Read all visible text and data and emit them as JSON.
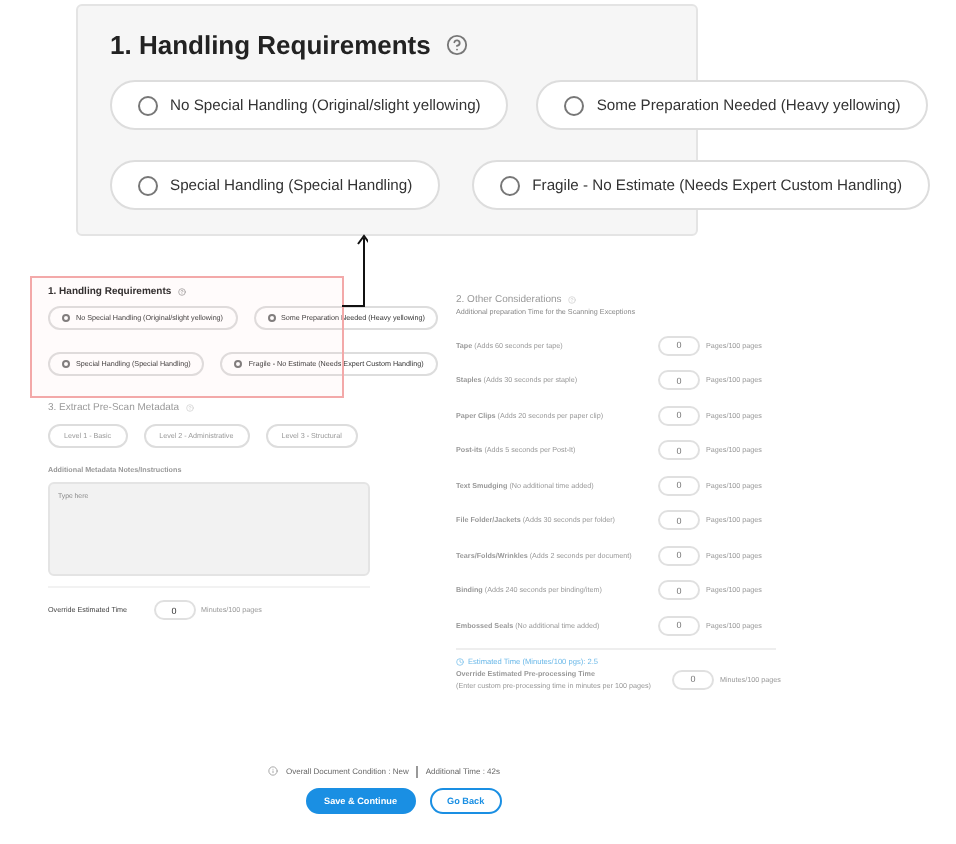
{
  "callout": {
    "title": "1. Handling Requirements",
    "options": [
      {
        "label": "No Special Handling (Original/slight yellowing)",
        "selected": false
      },
      {
        "label": "Some Preparation Needed (Heavy yellowing)",
        "selected": false
      },
      {
        "label": "Special  Handling (Special  Handling)",
        "selected": false
      },
      {
        "label": "Fragile - No Estimate (Needs Expert Custom Handling)",
        "selected": false
      }
    ]
  },
  "form": {
    "handling": {
      "title": "1. Handling Requirements",
      "dimmed": false,
      "options": [
        {
          "label": "No Special Handling (Original/slight yellowing)",
          "selected": false
        },
        {
          "label": "Some Preparation Needed (Heavy yellowing)",
          "selected": false
        },
        {
          "label": "Special  Handling (Special  Handling)",
          "selected": false
        },
        {
          "label": "Fragile - No Estimate (Needs Expert Custom Handling)",
          "selected": false
        }
      ]
    },
    "metadata": {
      "title": "3. Extract Pre-Scan Metadata",
      "dimmed": true,
      "levels": [
        {
          "label": "Level 1 - Basic",
          "selected": false
        },
        {
          "label": "Level 2 - Administrative",
          "selected": false
        },
        {
          "label": "Level 3 - Structural",
          "selected": false
        }
      ],
      "notes": {
        "label": "Additional Metadata Notes/Instructions",
        "placeholder": "Type here"
      }
    },
    "override_time": {
      "label": "Override Estimated Time",
      "value": "0",
      "unit": "Minutes/100 pages"
    },
    "considerations": {
      "title": "2. Other Considerations",
      "subtitle": "Additional preparation Time for the Scanning Exceptions",
      "dimmed": true,
      "items": [
        {
          "label": "Tape",
          "hint": "(Adds 60 seconds per tape)",
          "value": "0",
          "unit": "Pages/100 pages"
        },
        {
          "label": "Staples",
          "hint": "(Adds 30 seconds per staple)",
          "value": "0",
          "unit": "Pages/100 pages"
        },
        {
          "label": "Paper Clips",
          "hint": "(Adds 20 seconds per paper clip)",
          "value": "0",
          "unit": "Pages/100 pages"
        },
        {
          "label": "Post-its",
          "hint": "(Adds 5 seconds per Post-It)",
          "value": "0",
          "unit": "Pages/100 pages"
        },
        {
          "label": "Text Smudging",
          "hint": "(No additional time added)",
          "value": "0",
          "unit": "Pages/100 pages"
        },
        {
          "label": "File Folder/Jackets",
          "hint": "(Adds 30 seconds per folder)",
          "value": "0",
          "unit": "Pages/100 pages"
        },
        {
          "label": "Tears/Folds/Wrinkles",
          "hint": "(Adds 2 seconds per document)",
          "value": "0",
          "unit": "Pages/100 pages"
        },
        {
          "label": "Binding",
          "hint": "(Adds 240 seconds per binding/item)",
          "value": "0",
          "unit": "Pages/100 pages"
        },
        {
          "label": "Embossed Seals",
          "hint": "(No additional time added)",
          "value": "0",
          "unit": "Pages/100 pages"
        }
      ],
      "estimate": "Estimated Time (Minutes/100 pgs): 2.5",
      "override": {
        "label": "Override Estimated Pre-processing Time",
        "hint": "(Enter custom pre-processing time in minutes per 100 pages)",
        "value": "0",
        "unit": "Minutes/100 pages"
      }
    }
  },
  "summary": {
    "condition": "Overall Document Condition : New",
    "additional": "Additional Time : 42s"
  },
  "buttons": [
    {
      "label": "Save & Continue",
      "kind": "primary"
    },
    {
      "label": "Go Back",
      "kind": "secondary"
    }
  ]
}
